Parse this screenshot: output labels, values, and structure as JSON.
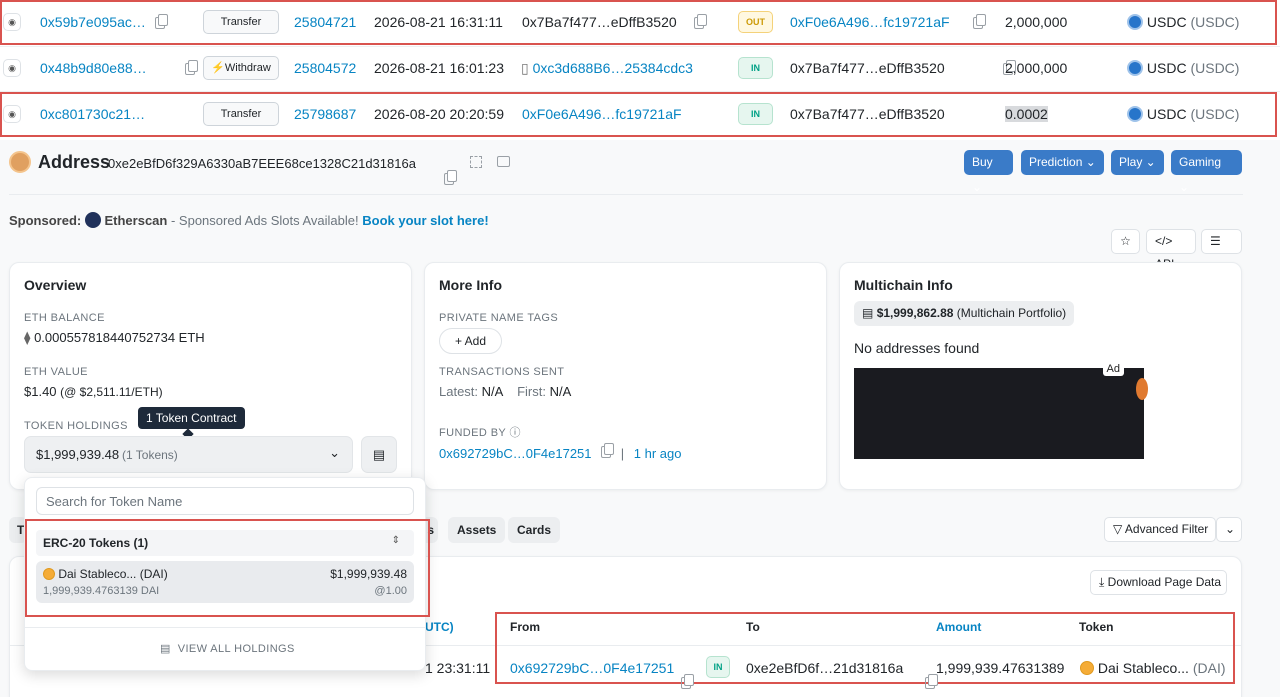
{
  "top_rows": [
    {
      "hash": "0x59b7e095ac…",
      "method": "Transfer",
      "block": "25804721",
      "time": "2026-08-21 16:31:11",
      "from": "0x7Ba7f477…eDffB3520",
      "direction": "OUT",
      "to": "0xF0e6A496…fc19721aF",
      "amount": "2,000,000",
      "token": "USDC",
      "token_sym": "(USDC)"
    },
    {
      "hash": "0x48b9d80e88…",
      "method": "Withdraw",
      "block": "25804572",
      "time": "2026-08-21 16:01:23",
      "from": "0xc3d688B6…25384cdc3",
      "direction": "IN",
      "to": "0x7Ba7f477…eDffB3520",
      "amount": "2,000,000",
      "token": "USDC",
      "token_sym": "(USDC)"
    },
    {
      "hash": "0xc801730c21…",
      "method": "Transfer",
      "block": "25798687",
      "time": "2026-08-20 20:20:59",
      "from": "0xF0e6A496…fc19721aF",
      "direction": "IN",
      "to": "0x7Ba7f477…eDffB3520",
      "amount": "0.0002",
      "token": "USDC",
      "token_sym": "(USDC)"
    }
  ],
  "address": {
    "title": "Address",
    "value": "0xe2eBfD6f329A6330aB7EEE68ce1328C21d31816a"
  },
  "header_buttons": [
    "Buy",
    "Prediction",
    "Play",
    "Gaming"
  ],
  "sponsored": {
    "prefix": "Sponsored:",
    "brand": "Etherscan",
    "text": " - Sponsored Ads Slots Available! ",
    "cta": "Book your slot here!"
  },
  "toolbar": {
    "api": "API"
  },
  "overview": {
    "title": "Overview",
    "eth_balance_label": "ETH BALANCE",
    "eth_balance": "0.000557818440752734 ETH",
    "eth_value_label": "ETH VALUE",
    "eth_value": "$1.40",
    "eth_price": "(@ $2,511.11/ETH)",
    "token_holdings_label": "TOKEN HOLDINGS",
    "tooltip": "1 Token Contract",
    "holdings_value": "$1,999,939.48",
    "holdings_count": "(1 Tokens)"
  },
  "more_info": {
    "title": "More Info",
    "private_tags_label": "PRIVATE NAME TAGS",
    "add_label": "Add",
    "tx_sent_label": "TRANSACTIONS SENT",
    "latest_label": "Latest:",
    "latest_value": "N/A",
    "first_label": "First:",
    "first_value": "N/A",
    "funded_by_label": "FUNDED BY",
    "funded_by": "0x692729bC…0F4e17251",
    "funded_ago": "1 hr ago"
  },
  "multichain": {
    "title": "Multichain Info",
    "portfolio_value": "$1,999,862.88",
    "portfolio_label": "(Multichain Portfolio)",
    "no_addresses": "No addresses found",
    "ad_label": "Ad"
  },
  "dropdown": {
    "search_placeholder": "Search for Token Name",
    "section_title": "ERC-20 Tokens (1)",
    "token_name": "Dai Stableco... (DAI)",
    "token_value": "$1,999,939.48",
    "token_amount": "1,999,939.4763139 DAI",
    "token_price": "@1.00",
    "view_all": "VIEW ALL HOLDINGS"
  },
  "tabs": {
    "partial": "T",
    "partial2": "s",
    "assets": "Assets",
    "cards": "Cards"
  },
  "advanced_filter": "Advanced Filter",
  "download": "Download Page Data",
  "table": {
    "partial_header": "UTC)",
    "headers": {
      "from": "From",
      "to": "To",
      "amount": "Amount",
      "token": "Token"
    },
    "row": {
      "time_partial": "1 23:31:11",
      "from": "0x692729bC…0F4e17251",
      "direction": "IN",
      "to": "0xe2eBfD6f…21d31816a",
      "amount": "1,999,939.47631389",
      "token": "Dai Stableco...",
      "token_sym": "(DAI)"
    }
  }
}
